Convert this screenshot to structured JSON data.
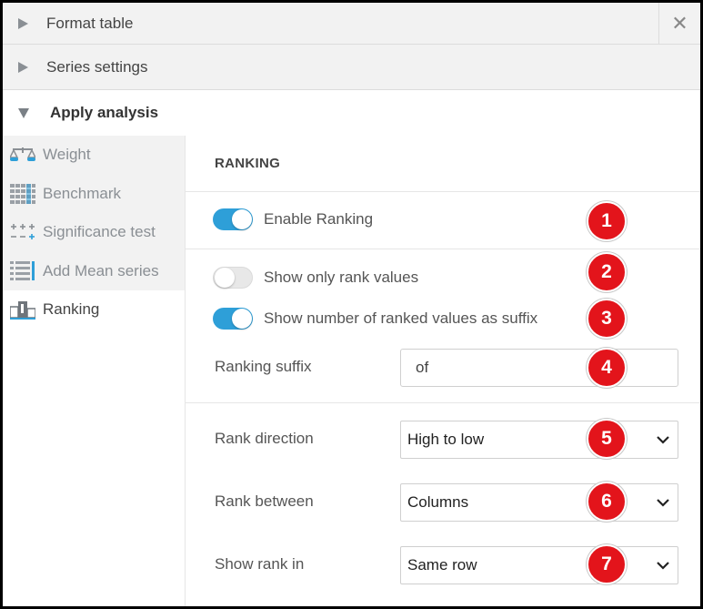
{
  "accordion": {
    "format_table": "Format table",
    "series_settings": "Series settings",
    "apply_analysis": "Apply analysis",
    "close_glyph": "✕"
  },
  "sidebar": {
    "items": [
      {
        "label": "Weight",
        "icon": "scale-icon"
      },
      {
        "label": "Benchmark",
        "icon": "grid-table-icon"
      },
      {
        "label": "Significance test",
        "icon": "plus-minus-grid-icon"
      },
      {
        "label": "Add Mean series",
        "icon": "list-lines-icon"
      },
      {
        "label": "Ranking",
        "icon": "podium-icon"
      }
    ],
    "active": "Ranking"
  },
  "ranking": {
    "title": "RANKING",
    "enable_ranking": {
      "label": "Enable Ranking",
      "on": true
    },
    "show_only_rank_values": {
      "label": "Show only rank values",
      "on": false
    },
    "show_number_suffix": {
      "label": "Show number of ranked values as suffix",
      "on": true
    },
    "ranking_suffix": {
      "label": "Ranking suffix",
      "value": "of"
    },
    "rank_direction": {
      "label": "Rank direction",
      "value": "High to low"
    },
    "rank_between": {
      "label": "Rank between",
      "value": "Columns"
    },
    "show_rank_in": {
      "label": "Show rank in",
      "value": "Same row"
    }
  },
  "badges": [
    "1",
    "2",
    "3",
    "4",
    "5",
    "6",
    "7"
  ],
  "colors": {
    "toggle_on": "#2e9fd8",
    "badge": "#e3141b",
    "sidebar_bg": "#f2f2f2"
  }
}
